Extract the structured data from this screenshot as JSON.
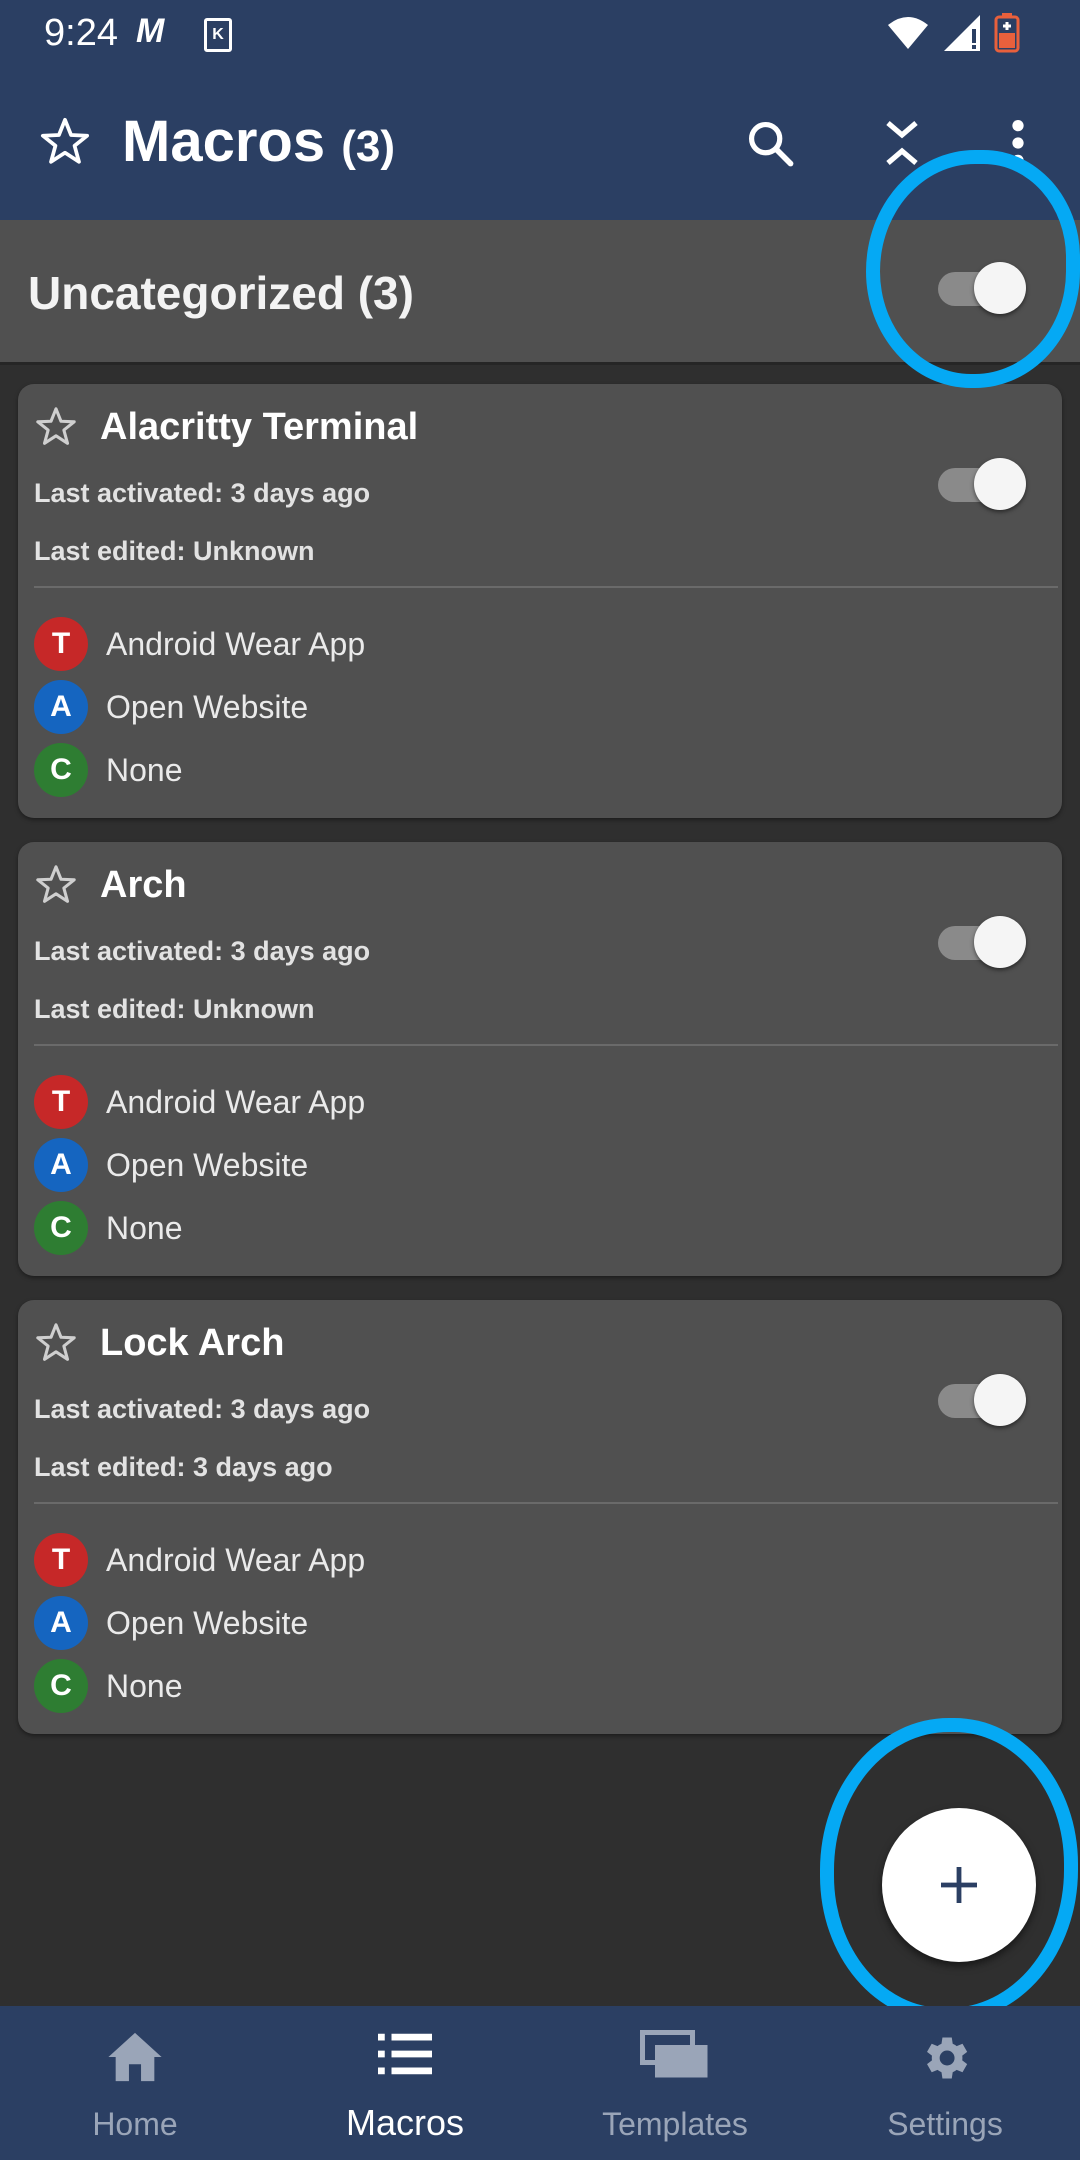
{
  "status_bar": {
    "time": "9:24",
    "m_icon_text": "M",
    "k_icon_text": "K",
    "icons": [
      "wifi-icon",
      "signal-icon",
      "battery-icon"
    ]
  },
  "app_bar": {
    "title": "Macros",
    "count": "(3)",
    "icons": [
      "star-outline-icon",
      "search-icon",
      "collapse-icon",
      "more-vert-icon"
    ]
  },
  "category": {
    "title": "Uncategorized (3)",
    "enabled": true
  },
  "macros": [
    {
      "title": "Alacritty Terminal",
      "last_activated": "Last activated: 3 days ago",
      "last_edited": "Last edited: Unknown",
      "enabled": true,
      "trigger": {
        "letter": "T",
        "text": "Android Wear App",
        "color": "#c62828"
      },
      "action": {
        "letter": "A",
        "text": "Open Website",
        "color": "#1565c0"
      },
      "constraint": {
        "letter": "C",
        "text": "None",
        "color": "#2e7d32"
      }
    },
    {
      "title": "Arch",
      "last_activated": "Last activated: 3 days ago",
      "last_edited": "Last edited: Unknown",
      "enabled": true,
      "trigger": {
        "letter": "T",
        "text": "Android Wear App",
        "color": "#c62828"
      },
      "action": {
        "letter": "A",
        "text": "Open Website",
        "color": "#1565c0"
      },
      "constraint": {
        "letter": "C",
        "text": "None",
        "color": "#2e7d32"
      }
    },
    {
      "title": "Lock Arch",
      "last_activated": "Last activated: 3 days ago",
      "last_edited": "Last edited: 3 days ago",
      "enabled": true,
      "trigger": {
        "letter": "T",
        "text": "Android Wear App",
        "color": "#c62828"
      },
      "action": {
        "letter": "A",
        "text": "Open Website",
        "color": "#1565c0"
      },
      "constraint": {
        "letter": "C",
        "text": "None",
        "color": "#2e7d32"
      }
    }
  ],
  "fab": {
    "icon": "plus-icon"
  },
  "bottom_nav": {
    "items": [
      {
        "label": "Home",
        "icon": "home-icon",
        "active": false
      },
      {
        "label": "Macros",
        "icon": "list-icon",
        "active": true
      },
      {
        "label": "Templates",
        "icon": "templates-icon",
        "active": false
      },
      {
        "label": "Settings",
        "icon": "gear-icon",
        "active": false
      }
    ]
  },
  "colors": {
    "primary": "#2b3f63",
    "background": "#2f2f2f",
    "card": "#505050",
    "highlight_ring": "#05a9f4"
  }
}
